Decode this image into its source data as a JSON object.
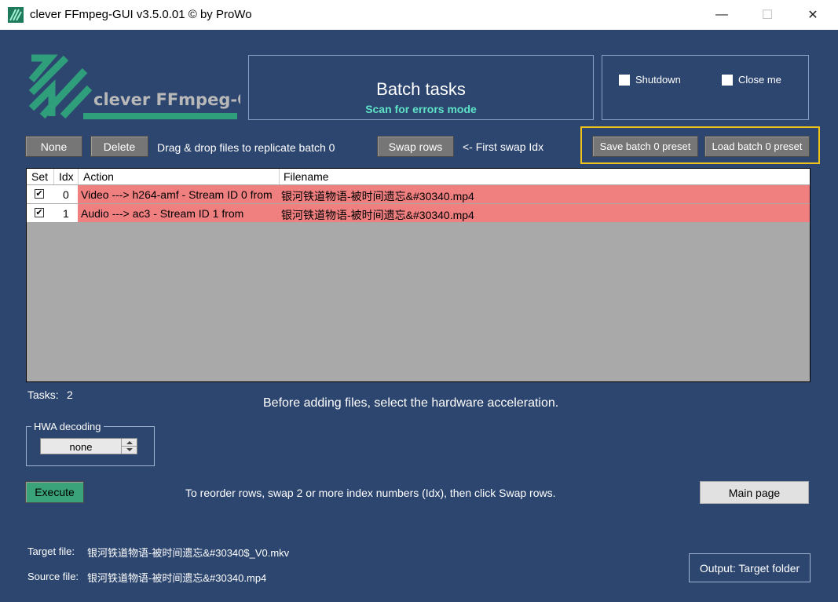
{
  "window": {
    "title": "clever FFmpeg-GUI v3.5.0.01   © by ProWo",
    "minimize": "—",
    "maximize": "☐",
    "close": "✕"
  },
  "logo": {
    "text": "clever FFmpeg-GUI"
  },
  "header": {
    "title": "Batch tasks",
    "subtitle": "Scan for errors mode",
    "subtitle_color": "#5fe3c7"
  },
  "options": {
    "shutdown": "Shutdown",
    "close_me": "Close me"
  },
  "toolbar": {
    "none": "None",
    "delete": "Delete",
    "drag_hint": "Drag & drop files to replicate batch 0",
    "swap_rows": "Swap rows",
    "swap_hint": "<- First swap Idx",
    "save_preset": "Save batch 0 preset",
    "load_preset": "Load batch 0 preset",
    "highlight_color": "#f2c21b"
  },
  "table": {
    "columns": [
      "Set",
      "Idx",
      "Action",
      "Filename"
    ],
    "rows": [
      {
        "set": true,
        "idx": "0",
        "action": "Video ---> h264-amf - Stream ID 0 from",
        "filename": "银河铁道物语-被时间遗忘&#30340.mp4"
      },
      {
        "set": true,
        "idx": "1",
        "action": "Audio ---> ac3 - Stream ID 1 from",
        "filename": "银河铁道物语-被时间遗忘&#30340.mp4"
      }
    ],
    "row_color": "#f08080"
  },
  "tasks": {
    "label": "Tasks:",
    "count": "2"
  },
  "hint_hw": "Before adding files, select the hardware acceleration.",
  "hwa": {
    "label": "HWA decoding",
    "value": "none"
  },
  "execute": "Execute",
  "reorder_hint": "To reorder rows, swap 2 or more index numbers (Idx), then click Swap rows.",
  "main_page": "Main page",
  "target_file": {
    "label": "Target file:",
    "value": "银河铁道物语-被时间遗忘&#30340$_V0.mkv"
  },
  "source_file": {
    "label": "Source file:",
    "value": "银河铁道物语-被时间遗忘&#30340.mp4"
  },
  "output_button": "Output: Target folder"
}
